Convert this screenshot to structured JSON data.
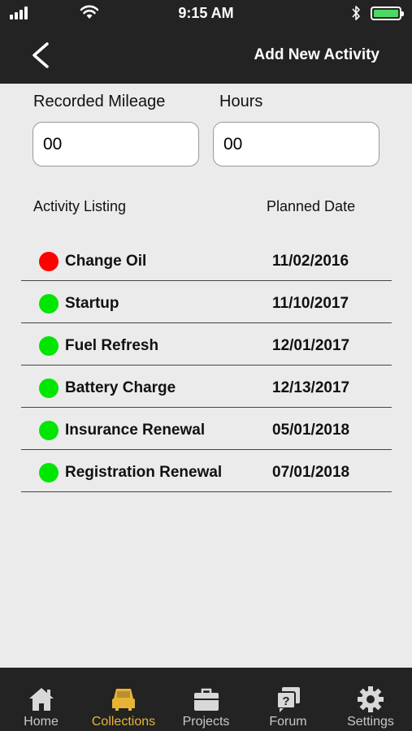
{
  "status": {
    "time": "9:15 AM",
    "battery_color": "#4cd964"
  },
  "nav": {
    "title": "Add New Activity"
  },
  "form": {
    "mileage_label": "Recorded Mileage",
    "mileage_value": "00",
    "hours_label": "Hours",
    "hours_value": "00"
  },
  "list": {
    "col_activity": "Activity Listing",
    "col_date": "Planned Date",
    "rows": [
      {
        "name": "Change Oil",
        "date": "11/02/2016",
        "status_color": "#ff0000"
      },
      {
        "name": "Startup",
        "date": "11/10/2017",
        "status_color": "#00e600"
      },
      {
        "name": "Fuel Refresh",
        "date": "12/01/2017",
        "status_color": "#00e600"
      },
      {
        "name": "Battery Charge",
        "date": "12/13/2017",
        "status_color": "#00e600"
      },
      {
        "name": "Insurance Renewal",
        "date": "05/01/2018",
        "status_color": "#00e600"
      },
      {
        "name": "Registration Renewal",
        "date": "07/01/2018",
        "status_color": "#00e600"
      }
    ]
  },
  "tabs": [
    {
      "label": "Home",
      "icon": "home-icon",
      "active": false
    },
    {
      "label": "Collections",
      "icon": "car-icon",
      "active": true
    },
    {
      "label": "Projects",
      "icon": "briefcase-icon",
      "active": false
    },
    {
      "label": "Forum",
      "icon": "forum-icon",
      "active": false
    },
    {
      "label": "Settings",
      "icon": "gear-icon",
      "active": false
    }
  ],
  "colors": {
    "accent": "#e8b436",
    "bar": "#232323",
    "background": "#ebebeb"
  }
}
